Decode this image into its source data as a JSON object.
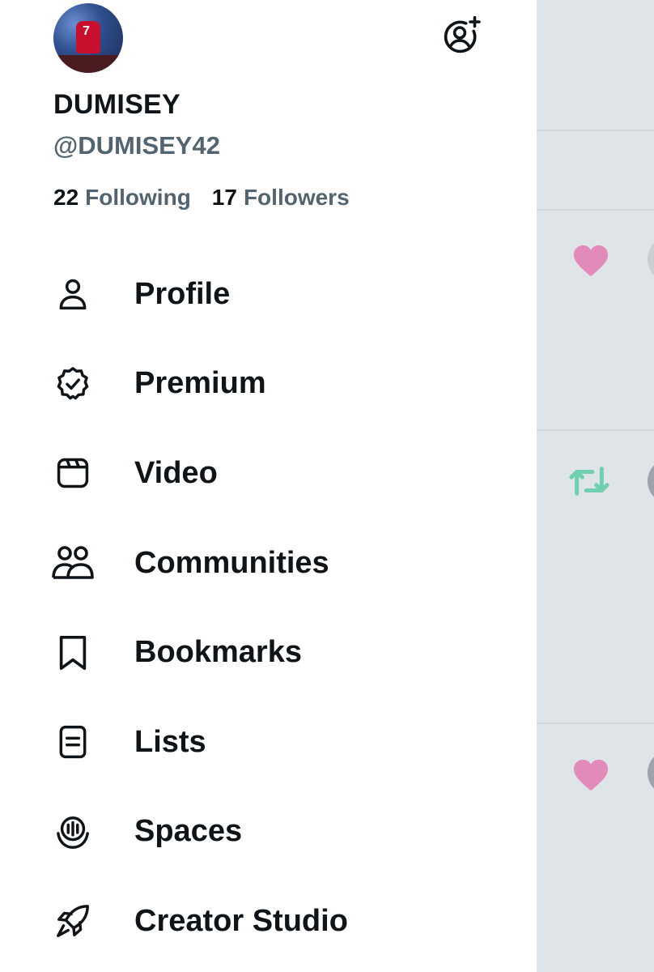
{
  "profile": {
    "display_name": "DUMISEY",
    "handle": "@DUMISEY42",
    "following_count": "22",
    "following_label": "Following",
    "followers_count": "17",
    "followers_label": "Followers",
    "avatar_jersey_number": "7"
  },
  "menu": {
    "items": [
      {
        "label": "Profile",
        "icon": "person-icon"
      },
      {
        "label": "Premium",
        "icon": "verified-badge-icon"
      },
      {
        "label": "Video",
        "icon": "video-icon"
      },
      {
        "label": "Communities",
        "icon": "communities-icon"
      },
      {
        "label": "Bookmarks",
        "icon": "bookmark-icon"
      },
      {
        "label": "Lists",
        "icon": "list-icon"
      },
      {
        "label": "Spaces",
        "icon": "spaces-icon"
      },
      {
        "label": "Creator Studio",
        "icon": "rocket-icon"
      }
    ]
  },
  "colors": {
    "text_primary": "#0f1419",
    "text_secondary": "#536471",
    "backdrop": "#dfe4e8",
    "like_pink": "#e38bb8",
    "retweet_green": "#6fcfae"
  }
}
